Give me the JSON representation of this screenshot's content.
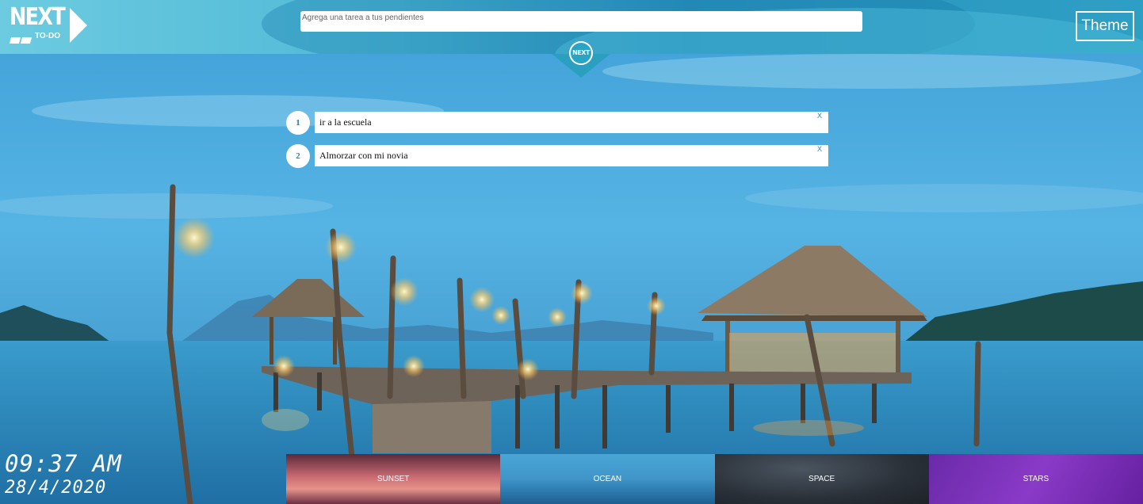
{
  "app": {
    "logo_text": "NEXT",
    "logo_subtext": "TO-DO"
  },
  "header": {
    "task_input_value": "",
    "task_input_placeholder": "Agrega una tarea a tus pendientes",
    "theme_button_label": "Theme",
    "next_badge": "NEXT"
  },
  "todos": [
    {
      "number": "1",
      "text": "ir a la escuela",
      "delete_label": "X"
    },
    {
      "number": "2",
      "text": "Almorzar con mi novia",
      "delete_label": "X"
    }
  ],
  "clock": {
    "time": "09:37 AM",
    "date": "28/4/2020"
  },
  "themes": [
    {
      "label": "SUNSET"
    },
    {
      "label": "OCEAN"
    },
    {
      "label": "SPACE"
    },
    {
      "label": "STARS"
    }
  ]
}
